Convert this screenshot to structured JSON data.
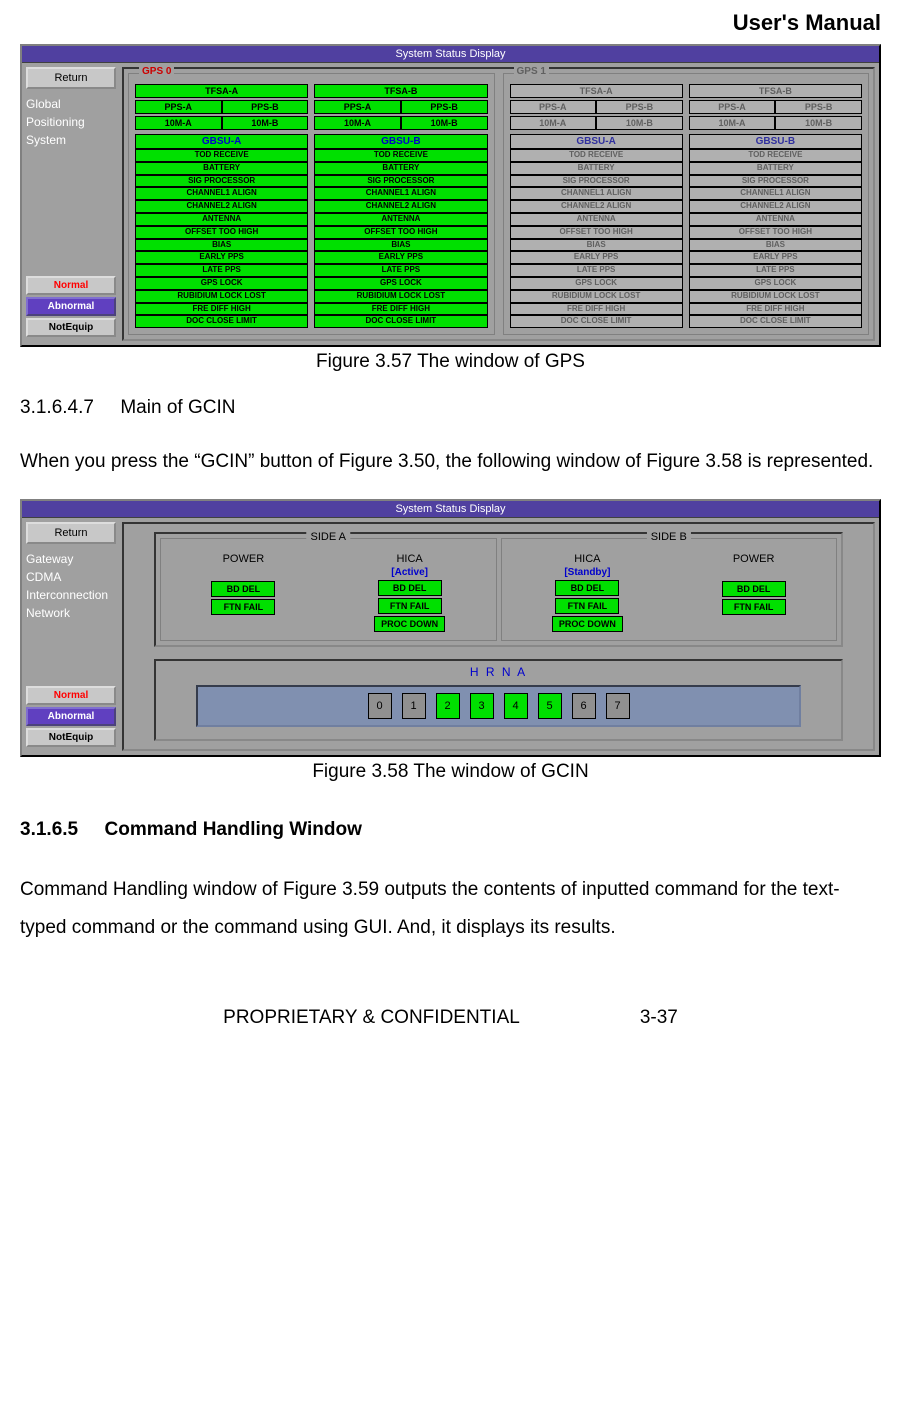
{
  "header": {
    "manual": "User's Manual"
  },
  "gps_window": {
    "title": "System Status Display",
    "return_btn": "Return",
    "side_label": "Global\nPositioning\nSystem",
    "legend": {
      "normal": "Normal",
      "abnormal": "Abnormal",
      "notequip": "NotEquip"
    },
    "groups": [
      {
        "label": "GPS 0",
        "active": true
      },
      {
        "label": "GPS 1",
        "active": false
      }
    ],
    "tfsa": {
      "a": "TFSA-A",
      "b": "TFSA-B"
    },
    "pps": {
      "a": "PPS-A",
      "b": "PPS-B"
    },
    "tenm": {
      "a": "10M-A",
      "b": "10M-B"
    },
    "gbsu": {
      "a": "GBSU-A",
      "b": "GBSU-B"
    },
    "gbsu_items": [
      "TOD RECEIVE",
      "BATTERY",
      "SIG PROCESSOR",
      "CHANNEL1 ALIGN",
      "CHANNEL2 ALIGN",
      "ANTENNA",
      "OFFSET TOO HIGH",
      "BIAS",
      "EARLY PPS",
      "LATE PPS",
      "GPS LOCK",
      "RUBIDIUM LOCK LOST",
      "FRE DIFF HIGH",
      "DOC CLOSE LIMIT"
    ]
  },
  "caption1": "Figure 3.57 The window of GPS",
  "section1_num": "3.1.6.4.7",
  "section1_title": "Main of GCIN",
  "para1": "When you press the “GCIN” button of Figure 3.50, the following window of Figure 3.58 is represented.",
  "gcin_window": {
    "title": "System Status Display",
    "return_btn": "Return",
    "side_label": "Gateway\nCDMA\nInterconnection\nNetwork",
    "legend": {
      "normal": "Normal",
      "abnormal": "Abnormal",
      "notequip": "NotEquip"
    },
    "side_a": "SIDE A",
    "side_b": "SIDE B",
    "power": "POWER",
    "hica": "HICA",
    "active": "[Active]",
    "standby": "[Standby]",
    "items": {
      "bd_del": "BD DEL",
      "ftn_fail": "FTN FAIL",
      "proc_down": "PROC DOWN"
    },
    "hrna": "H R N A",
    "hrna_slots": [
      {
        "n": "0",
        "on": false
      },
      {
        "n": "1",
        "on": false
      },
      {
        "n": "2",
        "on": true
      },
      {
        "n": "3",
        "on": true
      },
      {
        "n": "4",
        "on": true
      },
      {
        "n": "5",
        "on": true
      },
      {
        "n": "6",
        "on": false
      },
      {
        "n": "7",
        "on": false
      }
    ]
  },
  "caption2": "Figure 3.58 The window of GCIN",
  "section2_num": "3.1.6.5",
  "section2_title": "Command Handling Window",
  "para2": "Command Handling window of Figure 3.59 outputs the contents of inputted command for the text-typed command or the command using GUI. And, it displays its results.",
  "footer": {
    "left": "PROPRIETARY & CONFIDENTIAL",
    "right": "3-37"
  }
}
